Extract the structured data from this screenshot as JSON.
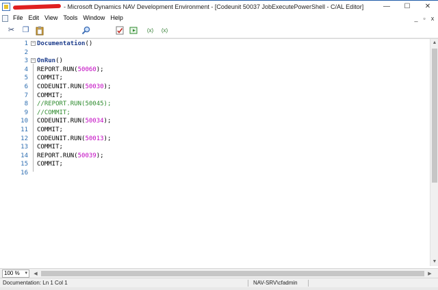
{
  "window": {
    "title": "- Microsoft Dynamics NAV Development Environment - [Codeunit 50037 JobExecutePowerShell - C/AL Editor]",
    "controls": [
      "—",
      "☐",
      "✕"
    ]
  },
  "menu": {
    "items": [
      "File",
      "Edit",
      "View",
      "Tools",
      "Window",
      "Help"
    ],
    "mdi_controls": [
      "_",
      "▫",
      "x"
    ]
  },
  "toolbar": {
    "icons": [
      "cut-icon",
      "copy-icon",
      "paste-icon",
      "find-icon",
      "compile-icon",
      "run-icon",
      "symbol-menu-icon",
      "symbol-menu-2-icon"
    ],
    "glyphs": {
      "cut": "✂",
      "copy": "❐",
      "paste": "📋",
      "find": "⚲",
      "compile": "☑",
      "run": "▣",
      "sym1": "(x)",
      "sym2": "(x)"
    }
  },
  "editor": {
    "lines": [
      {
        "num": "1",
        "text": "Documentation()"
      },
      {
        "num": "2",
        "text": ""
      },
      {
        "num": "3",
        "text": "OnRun()"
      },
      {
        "num": "4",
        "text": "REPORT.RUN(50060);"
      },
      {
        "num": "5",
        "text": "COMMIT;"
      },
      {
        "num": "6",
        "text": "CODEUNIT.RUN(50030);"
      },
      {
        "num": "7",
        "text": "COMMIT;"
      },
      {
        "num": "8",
        "text": "//REPORT.RUN(50045);"
      },
      {
        "num": "9",
        "text": "//COMMIT;"
      },
      {
        "num": "10",
        "text": "CODEUNIT.RUN(50034);"
      },
      {
        "num": "11",
        "text": "COMMIT;"
      },
      {
        "num": "12",
        "text": "CODEUNIT.RUN(50013);"
      },
      {
        "num": "13",
        "text": "COMMIT;"
      },
      {
        "num": "14",
        "text": "REPORT.RUN(50039);"
      },
      {
        "num": "15",
        "text": "COMMIT;"
      },
      {
        "num": "16",
        "text": ""
      }
    ]
  },
  "zoom": {
    "value": "100 %"
  },
  "status": {
    "position": "Documentation: Ln 1 Col 1",
    "server": "NAV-SRV\\cfadmin"
  },
  "colors": {
    "line_numbers": "#2b6cb0",
    "numbers": "#c000c0",
    "comments": "#2e8b2e",
    "triggers": "#1a3a8a"
  }
}
